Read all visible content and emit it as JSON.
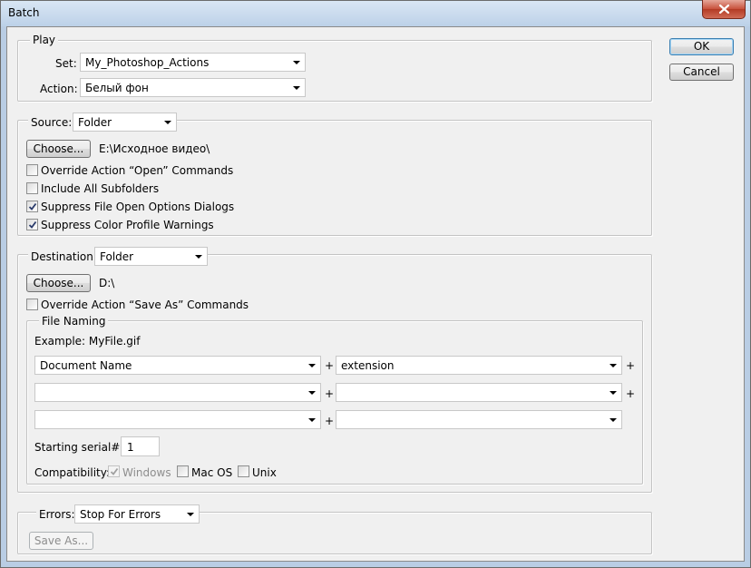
{
  "window": {
    "title": "Batch"
  },
  "buttons": {
    "ok": "OK",
    "cancel": "Cancel"
  },
  "play": {
    "legend": "Play",
    "set_label": "Set:",
    "set_value": "My_Photoshop_Actions",
    "action_label": "Action:",
    "action_value": "Белый фон"
  },
  "source": {
    "label": "Source:",
    "value": "Folder",
    "choose_label": "Choose...",
    "path": "E:\\Исходное видео\\",
    "options": [
      {
        "label": "Override Action “Open” Commands",
        "checked": false
      },
      {
        "label": "Include All Subfolders",
        "checked": false
      },
      {
        "label": "Suppress File Open Options Dialogs",
        "checked": true
      },
      {
        "label": "Suppress Color Profile Warnings",
        "checked": true
      }
    ]
  },
  "destination": {
    "label": "Destination:",
    "value": "Folder",
    "choose_label": "Choose...",
    "path": "D:\\",
    "override_label": "Override Action “Save As” Commands",
    "override_checked": false
  },
  "file_naming": {
    "legend": "File Naming",
    "example": "Example: MyFile.gif",
    "fields": [
      [
        "Document Name",
        "extension"
      ],
      [
        "",
        ""
      ],
      [
        "",
        ""
      ]
    ],
    "plus": "+",
    "serial_label": "Starting serial#:",
    "serial_value": "1",
    "compat_label": "Compatibility:",
    "compat": [
      {
        "label": "Windows",
        "checked": true,
        "disabled": true
      },
      {
        "label": "Mac OS",
        "checked": false,
        "disabled": false
      },
      {
        "label": "Unix",
        "checked": false,
        "disabled": false
      }
    ]
  },
  "errors": {
    "label": "Errors:",
    "value": "Stop For Errors",
    "save_as_label": "Save As..."
  }
}
